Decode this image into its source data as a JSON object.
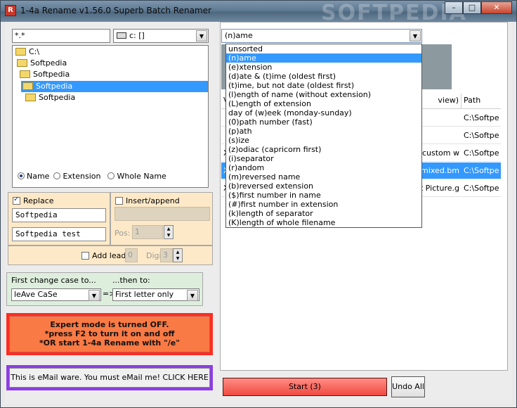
{
  "window": {
    "title": "1-4a Rename v1.56.0 Superb Batch Renamer",
    "watermark": "SOFTPEDIA",
    "icon_text": "R"
  },
  "left": {
    "filter_value": "*.*",
    "drive_value": "c: []",
    "tree": [
      {
        "label": "C:\\"
      },
      {
        "label": "Softpedia"
      },
      {
        "label": "Softpedia"
      },
      {
        "label": "Softpedia"
      },
      {
        "label": "Softpedia"
      }
    ],
    "name_options": [
      "Name",
      "Extension",
      "Whole Name"
    ],
    "replace_label": "Replace",
    "replace_from": "Softpedia",
    "replace_to": "Softpedia test",
    "insert_label": "Insert/append",
    "pos_label": "Pos:",
    "pos_value": "1",
    "add_lead_label": "Add lead",
    "lead_value": "0",
    "digits_label": "Digits:",
    "digits_value": "3",
    "case_first_label": "First change case to...",
    "case_then_label": "...then to:",
    "case_first_value": "leAve CaSe",
    "case_arrow": "=>",
    "case_then_value": "First letter only",
    "expert_lines": [
      "Expert mode is turned OFF.",
      "*press F2 to turn it on and off",
      "*OR start 1-4a Rename with \"/e\""
    ],
    "email_text": "This is eMail ware. You must eMail me! CLICK HERE"
  },
  "right": {
    "sort_value": "(n)ame",
    "table": {
      "columns": [
        "V",
        "view)",
        "Path"
      ],
      "rows": [
        {
          "mark": "",
          "name": "",
          "path": "C:\\Softpe"
        },
        {
          "mark": "",
          "name": "",
          "path": "C:\\Softpe"
        },
        {
          "mark": "X",
          "name": "st custom w",
          "path": "C:\\Softpe"
        },
        {
          "mark": "X",
          "name": "st mixed.bm",
          "path": "C:\\Softpe"
        },
        {
          "mark": "X",
          "name": "st Picture.g",
          "path": "C:\\Softpe"
        }
      ]
    },
    "sort_options": [
      "unsorted",
      "(n)ame",
      "(e)xtension",
      "(d)ate & (t)ime (oldest first)",
      "(t)ime, but not date (oldest first)",
      "(l)ength of name (without extension)",
      "(L)ength of extension",
      "day of (w)eek (monday-sunday)",
      "(0)path number (fast)",
      "(p)ath",
      "(s)ize",
      "(z)odiac (capricorn first)",
      "(i)separator",
      "(r)andom",
      "(m)reversed name",
      "(b)reversed extension",
      "($)first number in name",
      "(#)first number in extension",
      "(k)length of separator",
      "(K)length of whole filename"
    ],
    "start_label": "Start (3)",
    "undo_label": "Undo All"
  }
}
